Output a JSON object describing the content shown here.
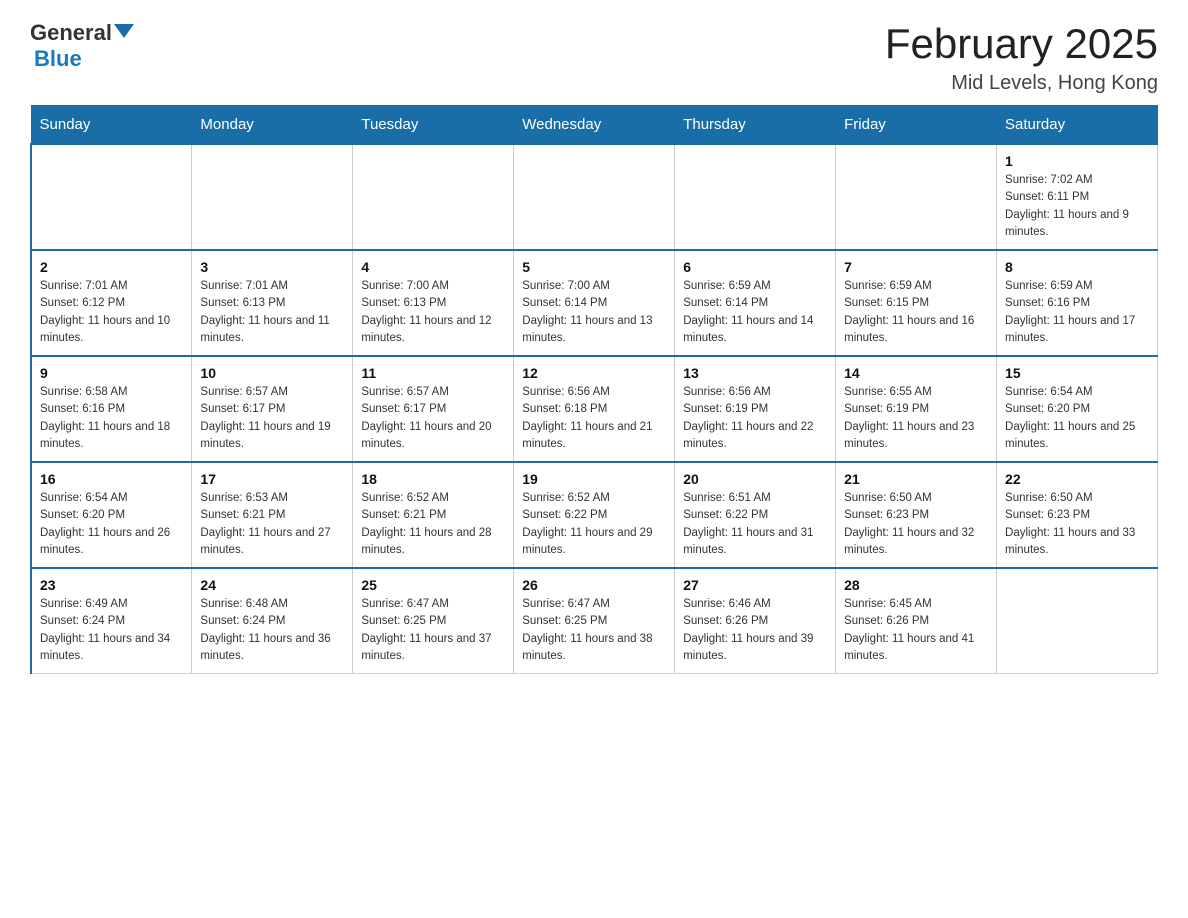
{
  "header": {
    "logo_general": "General",
    "logo_blue": "Blue",
    "month_title": "February 2025",
    "location": "Mid Levels, Hong Kong"
  },
  "weekdays": [
    "Sunday",
    "Monday",
    "Tuesday",
    "Wednesday",
    "Thursday",
    "Friday",
    "Saturday"
  ],
  "weeks": [
    [
      {
        "day": "",
        "info": ""
      },
      {
        "day": "",
        "info": ""
      },
      {
        "day": "",
        "info": ""
      },
      {
        "day": "",
        "info": ""
      },
      {
        "day": "",
        "info": ""
      },
      {
        "day": "",
        "info": ""
      },
      {
        "day": "1",
        "info": "Sunrise: 7:02 AM\nSunset: 6:11 PM\nDaylight: 11 hours and 9 minutes."
      }
    ],
    [
      {
        "day": "2",
        "info": "Sunrise: 7:01 AM\nSunset: 6:12 PM\nDaylight: 11 hours and 10 minutes."
      },
      {
        "day": "3",
        "info": "Sunrise: 7:01 AM\nSunset: 6:13 PM\nDaylight: 11 hours and 11 minutes."
      },
      {
        "day": "4",
        "info": "Sunrise: 7:00 AM\nSunset: 6:13 PM\nDaylight: 11 hours and 12 minutes."
      },
      {
        "day": "5",
        "info": "Sunrise: 7:00 AM\nSunset: 6:14 PM\nDaylight: 11 hours and 13 minutes."
      },
      {
        "day": "6",
        "info": "Sunrise: 6:59 AM\nSunset: 6:14 PM\nDaylight: 11 hours and 14 minutes."
      },
      {
        "day": "7",
        "info": "Sunrise: 6:59 AM\nSunset: 6:15 PM\nDaylight: 11 hours and 16 minutes."
      },
      {
        "day": "8",
        "info": "Sunrise: 6:59 AM\nSunset: 6:16 PM\nDaylight: 11 hours and 17 minutes."
      }
    ],
    [
      {
        "day": "9",
        "info": "Sunrise: 6:58 AM\nSunset: 6:16 PM\nDaylight: 11 hours and 18 minutes."
      },
      {
        "day": "10",
        "info": "Sunrise: 6:57 AM\nSunset: 6:17 PM\nDaylight: 11 hours and 19 minutes."
      },
      {
        "day": "11",
        "info": "Sunrise: 6:57 AM\nSunset: 6:17 PM\nDaylight: 11 hours and 20 minutes."
      },
      {
        "day": "12",
        "info": "Sunrise: 6:56 AM\nSunset: 6:18 PM\nDaylight: 11 hours and 21 minutes."
      },
      {
        "day": "13",
        "info": "Sunrise: 6:56 AM\nSunset: 6:19 PM\nDaylight: 11 hours and 22 minutes."
      },
      {
        "day": "14",
        "info": "Sunrise: 6:55 AM\nSunset: 6:19 PM\nDaylight: 11 hours and 23 minutes."
      },
      {
        "day": "15",
        "info": "Sunrise: 6:54 AM\nSunset: 6:20 PM\nDaylight: 11 hours and 25 minutes."
      }
    ],
    [
      {
        "day": "16",
        "info": "Sunrise: 6:54 AM\nSunset: 6:20 PM\nDaylight: 11 hours and 26 minutes."
      },
      {
        "day": "17",
        "info": "Sunrise: 6:53 AM\nSunset: 6:21 PM\nDaylight: 11 hours and 27 minutes."
      },
      {
        "day": "18",
        "info": "Sunrise: 6:52 AM\nSunset: 6:21 PM\nDaylight: 11 hours and 28 minutes."
      },
      {
        "day": "19",
        "info": "Sunrise: 6:52 AM\nSunset: 6:22 PM\nDaylight: 11 hours and 29 minutes."
      },
      {
        "day": "20",
        "info": "Sunrise: 6:51 AM\nSunset: 6:22 PM\nDaylight: 11 hours and 31 minutes."
      },
      {
        "day": "21",
        "info": "Sunrise: 6:50 AM\nSunset: 6:23 PM\nDaylight: 11 hours and 32 minutes."
      },
      {
        "day": "22",
        "info": "Sunrise: 6:50 AM\nSunset: 6:23 PM\nDaylight: 11 hours and 33 minutes."
      }
    ],
    [
      {
        "day": "23",
        "info": "Sunrise: 6:49 AM\nSunset: 6:24 PM\nDaylight: 11 hours and 34 minutes."
      },
      {
        "day": "24",
        "info": "Sunrise: 6:48 AM\nSunset: 6:24 PM\nDaylight: 11 hours and 36 minutes."
      },
      {
        "day": "25",
        "info": "Sunrise: 6:47 AM\nSunset: 6:25 PM\nDaylight: 11 hours and 37 minutes."
      },
      {
        "day": "26",
        "info": "Sunrise: 6:47 AM\nSunset: 6:25 PM\nDaylight: 11 hours and 38 minutes."
      },
      {
        "day": "27",
        "info": "Sunrise: 6:46 AM\nSunset: 6:26 PM\nDaylight: 11 hours and 39 minutes."
      },
      {
        "day": "28",
        "info": "Sunrise: 6:45 AM\nSunset: 6:26 PM\nDaylight: 11 hours and 41 minutes."
      },
      {
        "day": "",
        "info": ""
      }
    ]
  ]
}
